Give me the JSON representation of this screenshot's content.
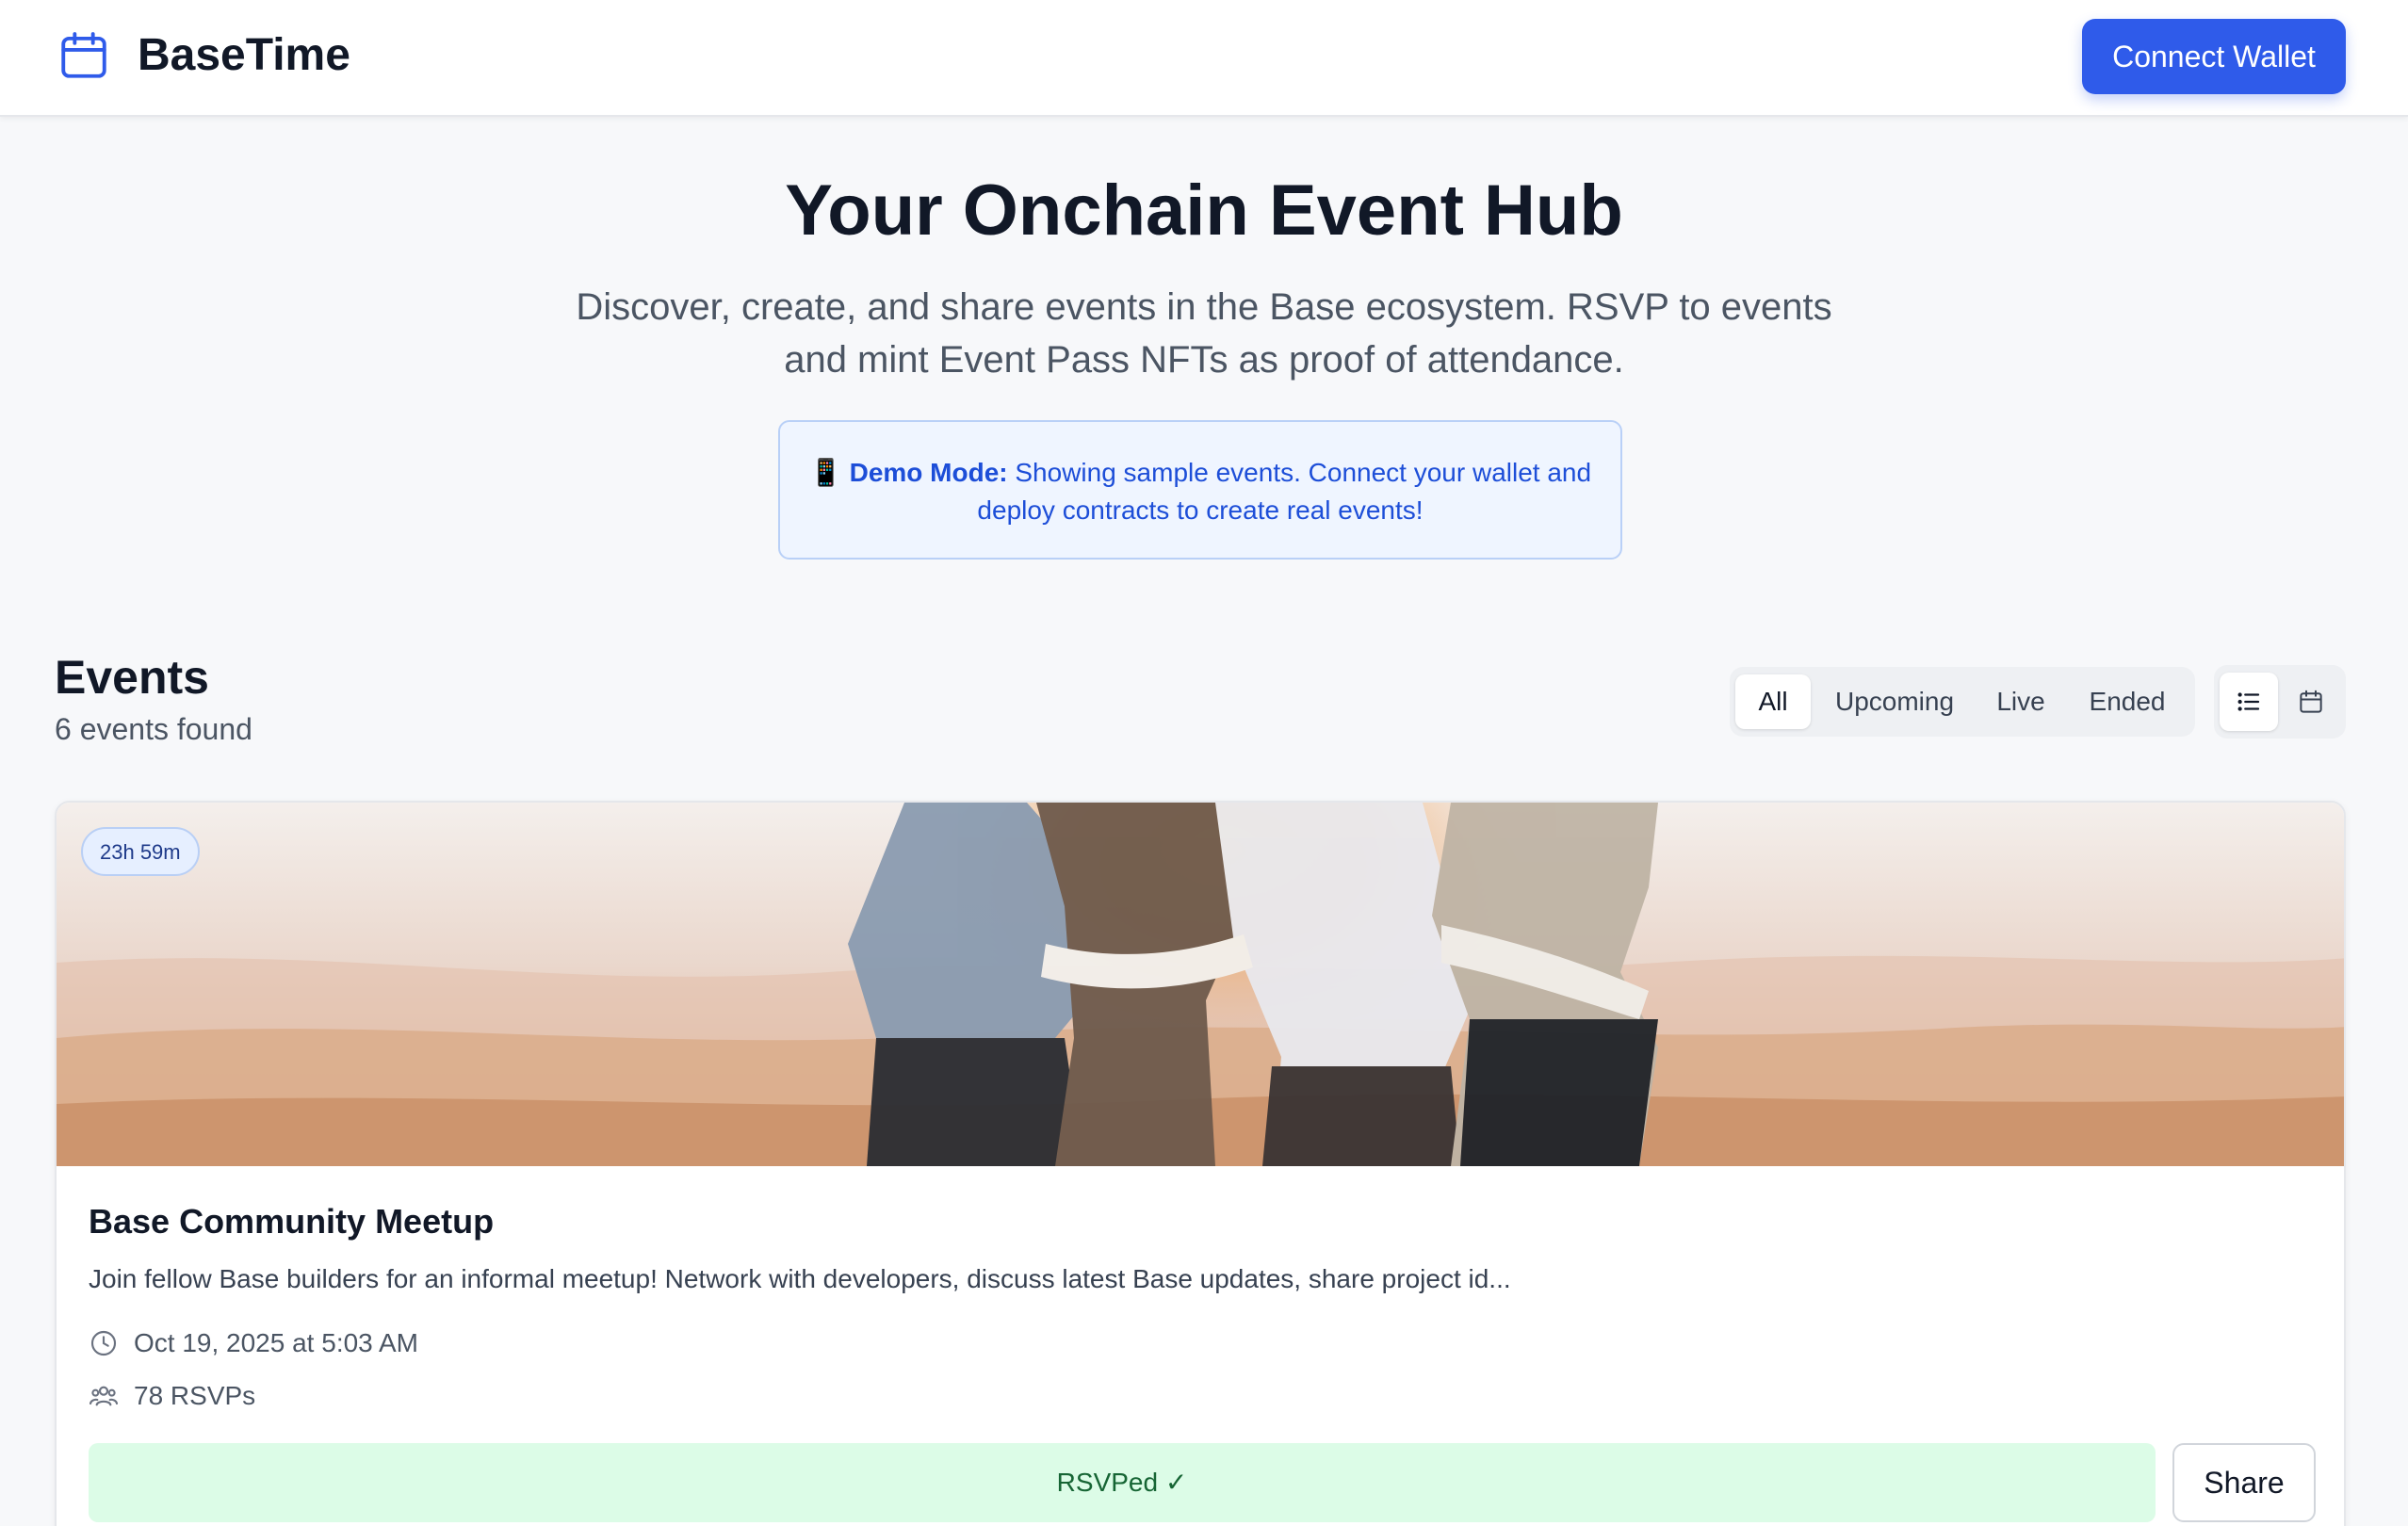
{
  "header": {
    "brand": "BaseTime",
    "brand_icon": "calendar-icon",
    "connect_label": "Connect Wallet"
  },
  "hero": {
    "title": "Your Onchain Event Hub",
    "subtitle": "Discover, create, and share events in the Base ecosystem. RSVP to events and mint Event Pass NFTs as proof of attendance.",
    "demo_emoji": "📱",
    "demo_label": "Demo Mode:",
    "demo_text": " Showing sample events. Connect your wallet and deploy contracts to create real events!"
  },
  "events": {
    "title": "Events",
    "count": "6 events found",
    "filters": [
      "All",
      "Upcoming",
      "Live",
      "Ended"
    ],
    "active_filter": "All",
    "view_modes": [
      "list-icon",
      "calendar-icon"
    ],
    "active_view": "list-icon"
  },
  "cards": [
    {
      "timer": "23h 59m",
      "title": "Base Community Meetup",
      "description": "Join fellow Base builders for an informal meetup! Network with developers, discuss latest Base updates, share project id...",
      "date": "Oct 19, 2025 at 5:03 AM",
      "date_icon": "clock-icon",
      "rsvps": "78 RSVPs",
      "rsvps_icon": "users-icon",
      "rsvp_status": "RSVPed ✓",
      "share_label": "Share"
    }
  ],
  "colors": {
    "accent": "#2f5bea",
    "rsvp_bg": "#dcfce7",
    "rsvp_text": "#166534",
    "demo_text": "#1d4ed8"
  }
}
